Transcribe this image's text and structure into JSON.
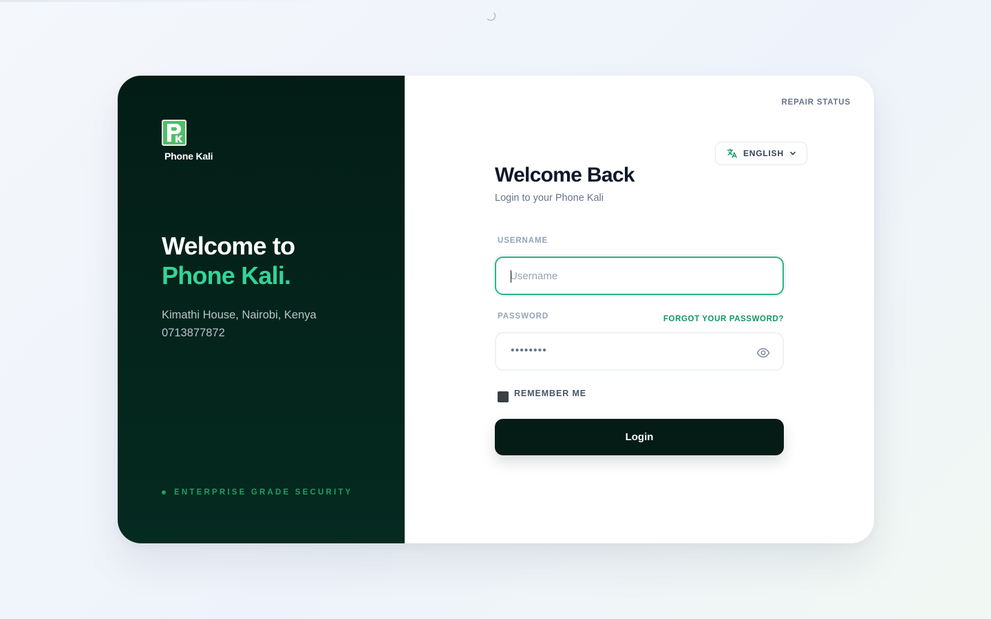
{
  "brand": {
    "name": "Phone Kali",
    "logo_letters": "PK",
    "logo_color": "#4fbf68"
  },
  "hero": {
    "title_line1": "Welcome to",
    "title_line2": "Phone Kali.",
    "accent_color": "#34d399",
    "address": "Kimathi House, Nairobi, Kenya",
    "phone": "0713877872",
    "security_text": "ENTERPRISE GRADE SECURITY"
  },
  "header": {
    "repair_status": "REPAIR STATUS",
    "language": {
      "selected": "ENGLISH",
      "icon": "translate-icon"
    }
  },
  "form": {
    "title": "Welcome Back",
    "subtitle": "Login to your Phone Kali",
    "username": {
      "label": "USERNAME",
      "placeholder": "Username",
      "value": ""
    },
    "password": {
      "label": "PASSWORD",
      "masked_value": "••••••••",
      "forgot_label": "FORGOT YOUR PASSWORD?",
      "toggle_icon": "eye-icon"
    },
    "remember_me": {
      "label": "REMEMBER ME",
      "checked": false
    },
    "submit_label": "Login"
  },
  "colors": {
    "panel_dark": "#031d16",
    "accent_green": "#11965f",
    "button_dark": "#051b16"
  }
}
